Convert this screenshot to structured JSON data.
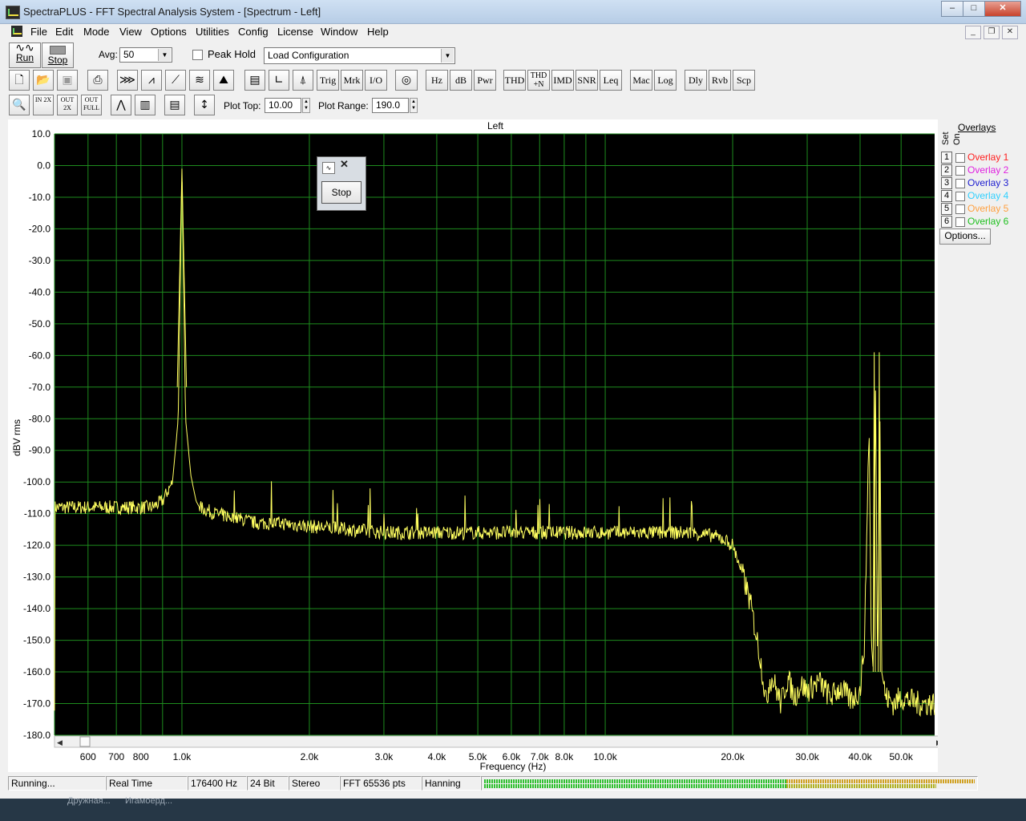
{
  "window": {
    "title": "SpectraPLUS - FFT Spectral Analysis System - [Spectrum - Left]",
    "min": "–",
    "max": "□",
    "close": "✕"
  },
  "mdi": {
    "min": "_",
    "restore": "❐",
    "close": "✕"
  },
  "menu": [
    "File",
    "Edit",
    "Mode",
    "View",
    "Options",
    "Utilities",
    "Config",
    "License",
    "Window",
    "Help"
  ],
  "toolbar1": {
    "run": "Run",
    "stop": "Stop",
    "avg_label": "Avg:",
    "avg_value": "50",
    "peak_hold": "Peak Hold",
    "config_value": "Load Configuration"
  },
  "toolbar2": [
    "Trig",
    "Mrk",
    "I/O",
    "Hz",
    "dB",
    "Pwr",
    "THD",
    "THD +N",
    "IMD",
    "SNR",
    "Leq",
    "Mac",
    "Log",
    "Dly",
    "Rvb",
    "Scp"
  ],
  "toolbar3": {
    "zoom_in": "IN 2X",
    "zoom_out": "OUT 2X",
    "zoom_full": "OUT FULL",
    "plot_top_label": "Plot Top:",
    "plot_top_value": "10.00",
    "plot_range_label": "Plot Range:",
    "plot_range_value": "190.0"
  },
  "popup": {
    "button": "Stop",
    "close": "✕"
  },
  "overlays": {
    "title": "Overlays",
    "col_set": "Set",
    "col_on": "On",
    "options": "Options...",
    "items": [
      {
        "num": "1",
        "name": "Overlay 1",
        "color": "#ff2020"
      },
      {
        "num": "2",
        "name": "Overlay 2",
        "color": "#e020e0"
      },
      {
        "num": "3",
        "name": "Overlay 3",
        "color": "#2020d0"
      },
      {
        "num": "4",
        "name": "Overlay 4",
        "color": "#30d0ff"
      },
      {
        "num": "5",
        "name": "Overlay 5",
        "color": "#ffa040"
      },
      {
        "num": "6",
        "name": "Overlay 6",
        "color": "#20c020"
      }
    ]
  },
  "status": [
    "Running...",
    "Real Time",
    "176400 Hz",
    "24 Bit",
    "Stereo",
    "FFT 65536 pts",
    "Hanning"
  ],
  "taskbar": [
    "Дружная...",
    "Игамоерд..."
  ],
  "chart_data": {
    "type": "line",
    "title": "Left",
    "xlabel": "Frequency (Hz)",
    "ylabel": "dBV rms",
    "xscale": "log",
    "xlim": [
      500,
      60000
    ],
    "ylim": [
      -180,
      10
    ],
    "grid": true,
    "background": "#000000",
    "grid_color": "#1e8c1e",
    "trace_color": "#ffff60",
    "yticks": [
      10,
      0,
      -10,
      -20,
      -30,
      -40,
      -50,
      -60,
      -70,
      -80,
      -90,
      -100,
      -110,
      -120,
      -130,
      -140,
      -150,
      -160,
      -170,
      -180
    ],
    "ytick_labels": [
      "10.0",
      "0.0",
      "-10.0",
      "-20.0",
      "-30.0",
      "-40.0",
      "-50.0",
      "-60.0",
      "-70.0",
      "-80.0",
      "-90.0",
      "-100.0",
      "-110.0",
      "-120.0",
      "-130.0",
      "-140.0",
      "-150.0",
      "-160.0",
      "-170.0",
      "-180.0"
    ],
    "xticks": [
      600,
      700,
      800,
      1000,
      2000,
      3000,
      4000,
      5000,
      6000,
      7000,
      8000,
      10000,
      20000,
      30000,
      40000,
      50000
    ],
    "xtick_labels": [
      "600",
      "700",
      "800",
      "1.0k",
      "2.0k",
      "3.0k",
      "4.0k",
      "5.0k",
      "6.0k",
      "7.0k",
      "8.0k",
      "10.0k",
      "20.0k",
      "30.0k",
      "40.0k",
      "50.0k"
    ],
    "xgrid": [
      500,
      600,
      700,
      800,
      900,
      1000,
      2000,
      3000,
      4000,
      5000,
      6000,
      7000,
      8000,
      9000,
      10000,
      20000,
      30000,
      40000,
      50000
    ],
    "series": [
      {
        "x": [
          500,
          600,
          700,
          800,
          850,
          900,
          950,
          980,
          1000,
          1020,
          1050,
          1080,
          1100,
          1150,
          1200,
          1300,
          1400,
          1500,
          1700,
          2000,
          2500,
          3000,
          3500,
          4000,
          5000,
          6000,
          7000,
          8000,
          10000,
          12000,
          14000,
          16000,
          18000,
          19000,
          20000,
          20500,
          21000,
          21500,
          22000,
          22500,
          23000,
          23500,
          24000,
          24500,
          25000,
          26000,
          27000,
          28000,
          29000,
          30000,
          32000,
          34000,
          36000,
          38000,
          40000,
          41000,
          42000,
          42500,
          43000,
          43500,
          44000,
          44500,
          45000,
          46000,
          48000,
          50000,
          55000,
          60000
        ],
        "y": [
          -108,
          -108,
          -108,
          -108,
          -108,
          -106,
          -100,
          -80,
          -1,
          -80,
          -98,
          -106,
          -108,
          -109,
          -110,
          -111,
          -112,
          -113,
          -113,
          -114,
          -115,
          -116,
          -116,
          -116,
          -116,
          -116,
          -116,
          -116,
          -116,
          -116,
          -116,
          -116,
          -117,
          -118,
          -120,
          -124,
          -128,
          -133,
          -138,
          -145,
          -152,
          -160,
          -170,
          -162,
          -163,
          -170,
          -162,
          -168,
          -164,
          -166,
          -163,
          -168,
          -165,
          -169,
          -166,
          -150,
          -80,
          -150,
          -160,
          -70,
          -160,
          -70,
          -160,
          -168,
          -170,
          -168,
          -170,
          -170
        ]
      }
    ]
  }
}
